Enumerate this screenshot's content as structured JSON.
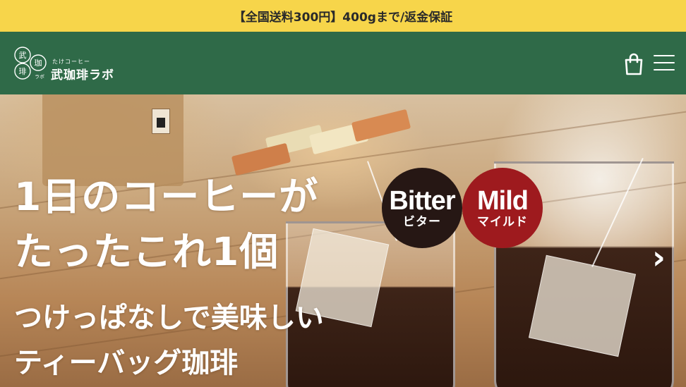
{
  "announcement": {
    "text": "【全国送料300円】400gまで/返金保証"
  },
  "header": {
    "logo": {
      "small": "たけコーヒー",
      "name": "武珈琲ラボ",
      "mark_chars": [
        "武",
        "珈",
        "琲",
        "ラボ"
      ]
    },
    "cart_icon": "shopping-bag-icon",
    "menu_icon": "hamburger-menu-icon"
  },
  "hero": {
    "headline": [
      "1日のコーヒーが",
      "たったこれ1個"
    ],
    "subheadline": [
      "つけっぱなしで美味しい",
      "ティーバッグ珈琲"
    ],
    "badges": [
      {
        "en": "Bitter",
        "jp": "ビター",
        "color": "#261714"
      },
      {
        "en": "Mild",
        "jp": "マイルド",
        "color": "#9e1a1e"
      }
    ],
    "prev_icon": "chevron-left-icon",
    "next_icon": "chevron-right-icon",
    "next_glyph": "›"
  },
  "colors": {
    "announcement_bg": "#f7d54a",
    "header_bg": "#2f6a48"
  }
}
